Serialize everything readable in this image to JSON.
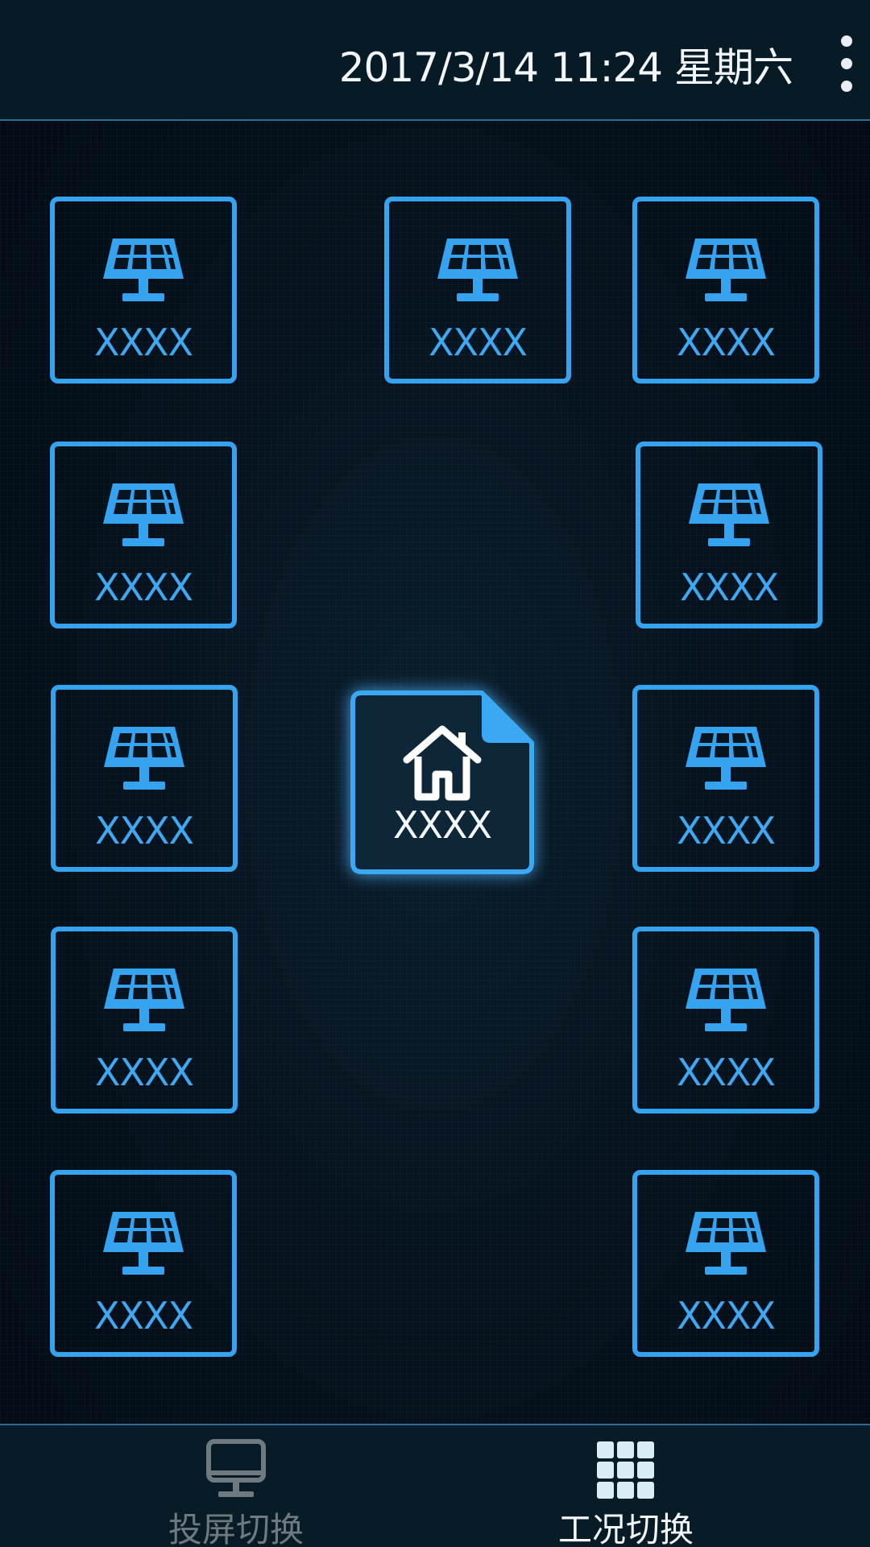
{
  "status_bar": {
    "datetime": "2017/3/14 11:24 星期六",
    "menu_icon": "more-vertical-icon"
  },
  "tiles": [
    {
      "label": "XXXX",
      "icon": "solar-panel-icon"
    },
    {
      "label": "XXXX",
      "icon": "solar-panel-icon"
    },
    {
      "label": "XXXX",
      "icon": "solar-panel-icon"
    },
    {
      "label": "XXXX",
      "icon": "solar-panel-icon"
    },
    {
      "label": "XXXX",
      "icon": "solar-panel-icon"
    },
    {
      "label": "XXXX",
      "icon": "solar-panel-icon"
    },
    {
      "label": "XXXX",
      "icon": "solar-panel-icon"
    },
    {
      "label": "XXXX",
      "icon": "solar-panel-icon"
    },
    {
      "label": "XXXX",
      "icon": "solar-panel-icon"
    },
    {
      "label": "XXXX",
      "icon": "solar-panel-icon"
    },
    {
      "label": "XXXX",
      "icon": "solar-panel-icon"
    }
  ],
  "center_tile": {
    "label": "XXXX",
    "icon": "home-icon"
  },
  "nav": {
    "items": [
      {
        "label": "投屏切换",
        "icon": "monitor-icon",
        "active": false
      },
      {
        "label": "工况切换",
        "icon": "grid-icon",
        "active": true
      }
    ]
  },
  "colors": {
    "accent": "#36a3f0",
    "background": "#020b13",
    "bar": "#081c28",
    "inactive": "#6f7980",
    "text": "#f4f7f9"
  }
}
